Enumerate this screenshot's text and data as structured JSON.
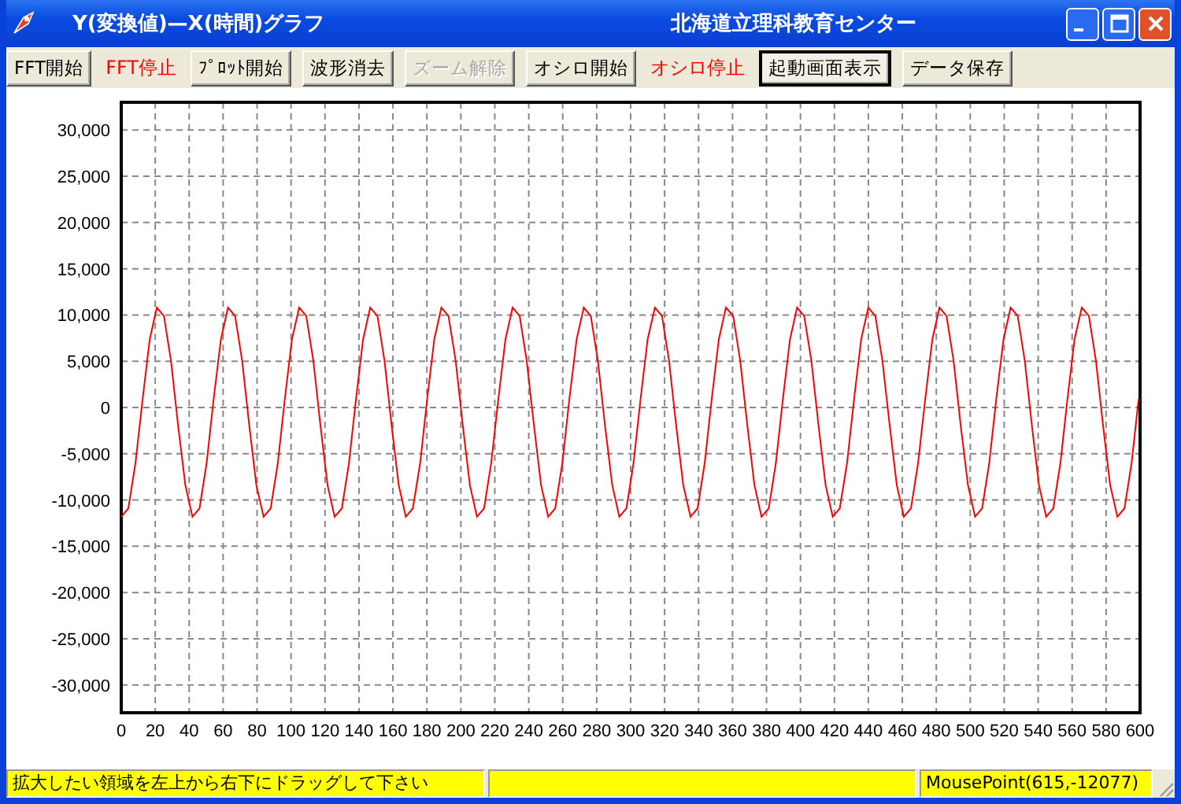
{
  "window": {
    "title": "Y(変換値)—X(時間)グラフ",
    "subtitle": "北海道立理科教育センター"
  },
  "toolbar": [
    {
      "label": "FFT開始",
      "kind": "button",
      "disabled": false,
      "focused": false
    },
    {
      "label": "FFT停止",
      "kind": "status-label"
    },
    {
      "label": "ﾌﾟﾛｯﾄ開始",
      "kind": "button",
      "disabled": false,
      "focused": false
    },
    {
      "label": "波形消去",
      "kind": "button",
      "disabled": false,
      "focused": false
    },
    {
      "label": "ズーム解除",
      "kind": "button",
      "disabled": true,
      "focused": false
    },
    {
      "label": "オシロ開始",
      "kind": "button",
      "disabled": false,
      "focused": false
    },
    {
      "label": "オシロ停止",
      "kind": "status-label"
    },
    {
      "label": "起動画面表示",
      "kind": "button",
      "disabled": false,
      "focused": true
    },
    {
      "label": "データ保存",
      "kind": "button",
      "disabled": false,
      "focused": false
    }
  ],
  "chart": {
    "chart_data": {
      "type": "line",
      "grid": true,
      "xlim": [
        0,
        600
      ],
      "ylim": [
        -33000,
        33000
      ],
      "xticks": [
        0,
        20,
        40,
        60,
        80,
        100,
        120,
        140,
        160,
        180,
        200,
        220,
        240,
        260,
        280,
        300,
        320,
        340,
        360,
        380,
        400,
        420,
        440,
        460,
        480,
        500,
        520,
        540,
        560,
        580,
        600
      ],
      "yticks": [
        {
          "value": 30000,
          "label": "30,000"
        },
        {
          "value": 25000,
          "label": "25,000"
        },
        {
          "value": 20000,
          "label": "20,000"
        },
        {
          "value": 15000,
          "label": "15,000"
        },
        {
          "value": 10000,
          "label": "10,000"
        },
        {
          "value": 5000,
          "label": "5,000"
        },
        {
          "value": 0,
          "label": "0"
        },
        {
          "value": -5000,
          "label": "-5,000"
        },
        {
          "value": -10000,
          "label": "-10,000"
        },
        {
          "value": -15000,
          "label": "-15,000"
        },
        {
          "value": -20000,
          "label": "-20,000"
        },
        {
          "value": -25000,
          "label": "-25,000"
        },
        {
          "value": -30000,
          "label": "-30,000"
        }
      ],
      "x": [
        0,
        4.19,
        8.38,
        12.57,
        16.76,
        20.95,
        25.14,
        29.33,
        33.52,
        37.71,
        41.9,
        46.09,
        50.28,
        54.47,
        58.66,
        62.85,
        67.04,
        71.23,
        75.42,
        79.61,
        83.8,
        87.99,
        92.18,
        96.37,
        100.56,
        104.75,
        108.94,
        113.13,
        117.32,
        121.51,
        125.7,
        129.89,
        134.08,
        138.27,
        142.46,
        146.65,
        150.84,
        155.03,
        159.22,
        163.41,
        167.6,
        171.79,
        175.98,
        180.17,
        184.36,
        188.55,
        192.74,
        196.93,
        201.12,
        205.31,
        209.5,
        213.69,
        217.88,
        222.07,
        226.26,
        230.45,
        234.64,
        238.83,
        243.02,
        247.21,
        251.4,
        255.59,
        259.78,
        263.97,
        268.16,
        272.35,
        276.54,
        280.73,
        284.92,
        289.11,
        293.3,
        297.49,
        301.68,
        305.87,
        310.06,
        314.25,
        318.44,
        322.63,
        326.82,
        331.01,
        335.2,
        339.39,
        343.58,
        347.77,
        351.96,
        356.15,
        360.34,
        364.53,
        368.72,
        372.91,
        377.1,
        381.29,
        385.48,
        389.67,
        393.86,
        398.05,
        402.24,
        406.43,
        410.62,
        414.81,
        419,
        423.19,
        427.38,
        431.57,
        435.76,
        439.95,
        444.14,
        448.33,
        452.52,
        456.71,
        460.9,
        465.09,
        469.28,
        473.47,
        477.66,
        481.85,
        486.04,
        490.23,
        494.42,
        498.61,
        502.8,
        506.99,
        511.18,
        515.37,
        519.56,
        523.75,
        527.94,
        532.13,
        536.32,
        540.51,
        544.7,
        548.89,
        553.08,
        557.27,
        561.46,
        565.65,
        569.84,
        574.03,
        578.22,
        582.41,
        586.6,
        590.79,
        594.98,
        599.17
      ],
      "series": [
        {
          "color": "#ff0000",
          "values": [
            -11800,
            -10900,
            -6040,
            940,
            7380,
            10800,
            9900,
            5040,
            -1940,
            -8380,
            -11800,
            -10900,
            -6040,
            940,
            7380,
            10800,
            9900,
            5040,
            -1940,
            -8380,
            -11800,
            -10900,
            -6040,
            940,
            7380,
            10800,
            9900,
            5040,
            -1940,
            -8380,
            -11800,
            -10900,
            -6040,
            940,
            7380,
            10800,
            9900,
            5040,
            -1940,
            -8380,
            -11800,
            -10900,
            -6040,
            940,
            7380,
            10800,
            9900,
            5040,
            -1940,
            -8380,
            -11800,
            -10900,
            -6040,
            940,
            7380,
            10800,
            9900,
            5040,
            -1940,
            -8380,
            -11800,
            -10900,
            -6040,
            940,
            7380,
            10800,
            9900,
            5040,
            -1940,
            -8380,
            -11800,
            -10900,
            -6040,
            940,
            7380,
            10800,
            9900,
            5040,
            -1940,
            -8380,
            -11800,
            -10900,
            -6040,
            940,
            7380,
            10800,
            9900,
            5040,
            -1940,
            -8380,
            -11800,
            -10900,
            -6040,
            940,
            7380,
            10800,
            9900,
            5040,
            -1940,
            -8380,
            -11800,
            -10900,
            -6040,
            940,
            7380,
            10800,
            9900,
            5040,
            -1940,
            -8380,
            -11800,
            -10900,
            -6040,
            940,
            7380,
            10800,
            9900,
            5040,
            -1940,
            -8380,
            -11800,
            -10900,
            -6040,
            940,
            7380,
            10800,
            9900,
            5040,
            -1940,
            -8380,
            -11800,
            -10900,
            -6040,
            940,
            7380,
            10800,
            9900,
            5040,
            -1940,
            -8380,
            -11800,
            -10900,
            -6040,
            940
          ]
        }
      ]
    }
  },
  "status_bar": {
    "message": "拡大したい領域を左上から右下にドラッグして下さい",
    "mouse_point": "MousePoint(615,-12077)"
  }
}
